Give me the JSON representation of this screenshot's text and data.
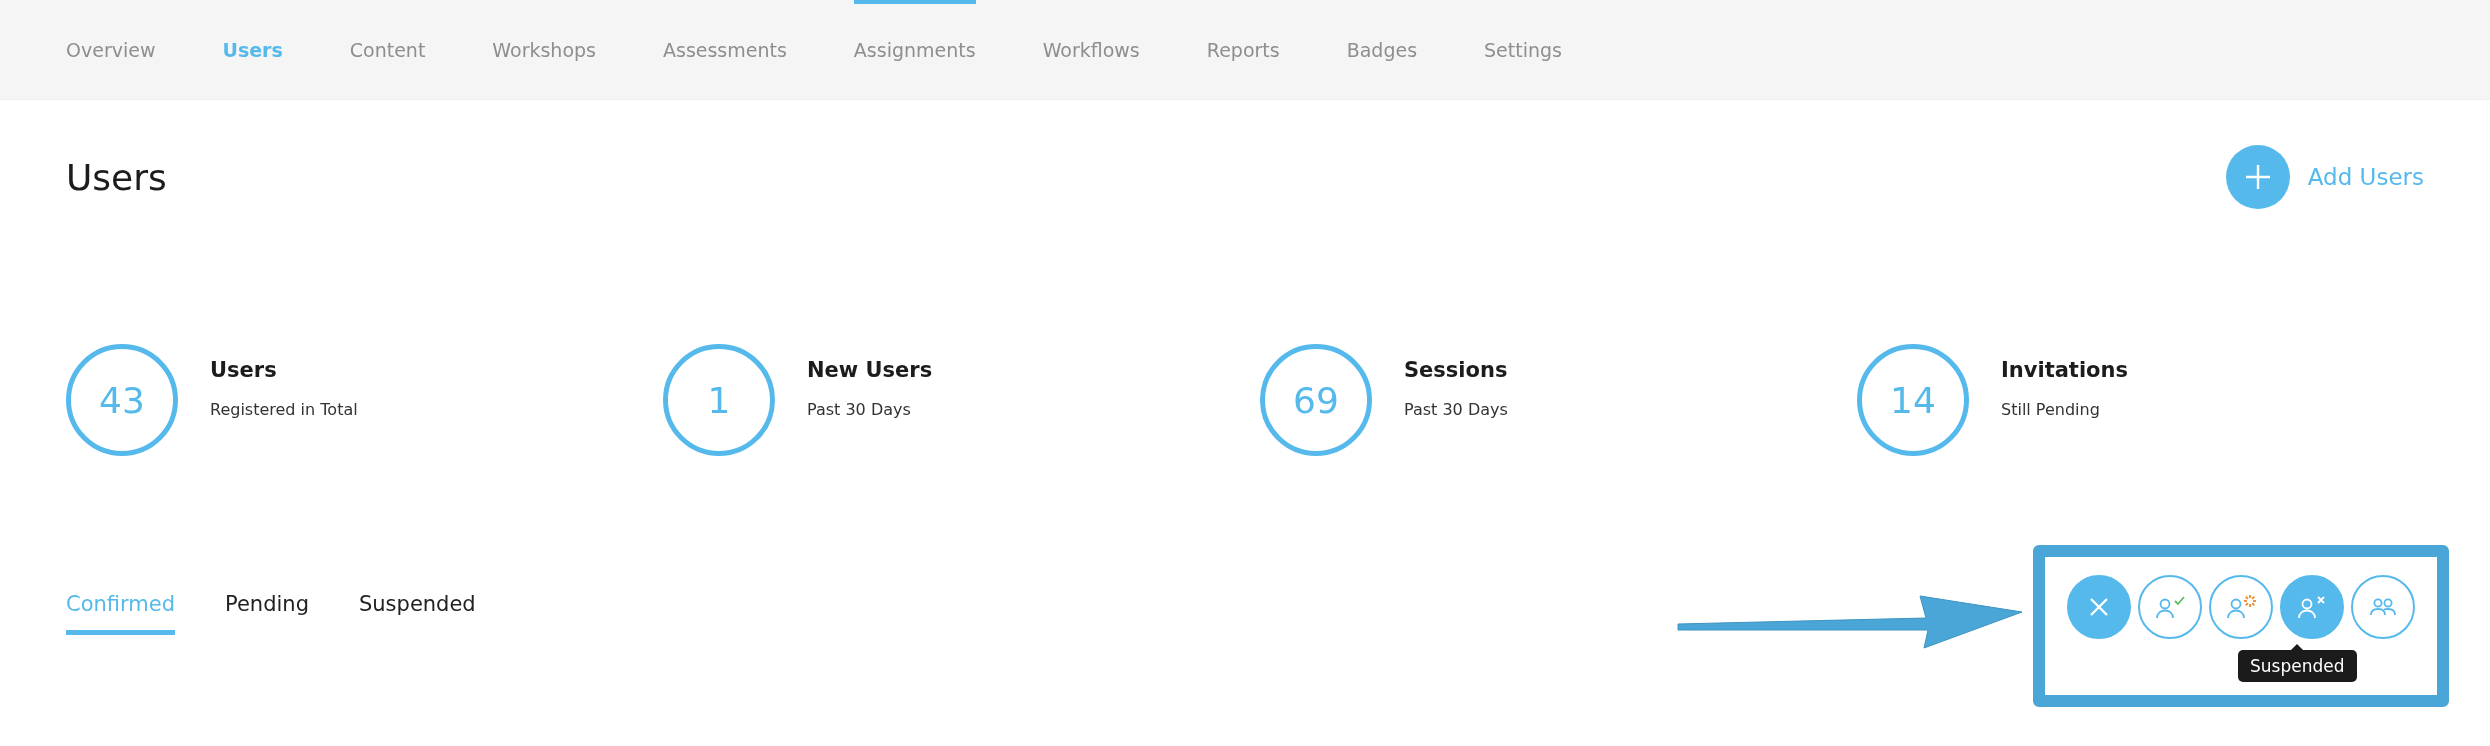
{
  "nav": {
    "items": [
      {
        "label": "Overview",
        "selected": false,
        "hovered": false
      },
      {
        "label": "Users",
        "selected": true,
        "hovered": false
      },
      {
        "label": "Content",
        "selected": false,
        "hovered": false
      },
      {
        "label": "Workshops",
        "selected": false,
        "hovered": false
      },
      {
        "label": "Assessments",
        "selected": false,
        "hovered": false
      },
      {
        "label": "Assignments",
        "selected": false,
        "hovered": true
      },
      {
        "label": "Workflows",
        "selected": false,
        "hovered": false
      },
      {
        "label": "Reports",
        "selected": false,
        "hovered": false
      },
      {
        "label": "Badges",
        "selected": false,
        "hovered": false
      },
      {
        "label": "Settings",
        "selected": false,
        "hovered": false
      }
    ]
  },
  "header": {
    "title": "Users",
    "add_button": "Add Users"
  },
  "stats": [
    {
      "value": "43",
      "title": "Users",
      "subtitle": "Registered in Total"
    },
    {
      "value": "1",
      "title": "New Users",
      "subtitle": "Past 30 Days"
    },
    {
      "value": "69",
      "title": "Sessions",
      "subtitle": "Past 30 Days"
    },
    {
      "value": "14",
      "title": "Invitations",
      "subtitle": "Still Pending"
    }
  ],
  "tabs": [
    {
      "label": "Confirmed",
      "selected": true
    },
    {
      "label": "Pending",
      "selected": false
    },
    {
      "label": "Suspended",
      "selected": false
    }
  ],
  "filter_menu": {
    "filters": [
      {
        "kind": "confirmed",
        "selected": false
      },
      {
        "kind": "pending",
        "selected": false
      },
      {
        "kind": "suspended",
        "selected": true
      },
      {
        "kind": "all",
        "selected": false
      }
    ],
    "tooltip": "Suspended"
  }
}
